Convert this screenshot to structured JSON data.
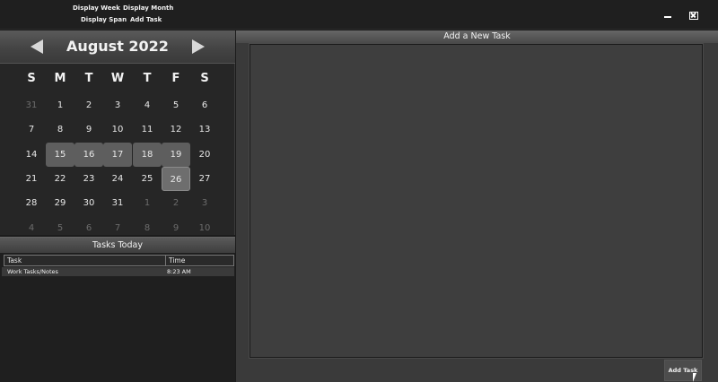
{
  "menu": {
    "display_week": "Display Week",
    "display_month": "Display Month",
    "display_span": "Display Span",
    "add_task": "Add Task"
  },
  "calendar": {
    "title": "August 2022",
    "weekdays": [
      "S",
      "M",
      "T",
      "W",
      "T",
      "F",
      "S"
    ],
    "weeks": [
      [
        "31",
        "1",
        "2",
        "3",
        "4",
        "5",
        "6"
      ],
      [
        "7",
        "8",
        "9",
        "10",
        "11",
        "12",
        "13"
      ],
      [
        "14",
        "15",
        "16",
        "17",
        "18",
        "19",
        "20"
      ],
      [
        "21",
        "22",
        "23",
        "24",
        "25",
        "26",
        "27"
      ],
      [
        "28",
        "29",
        "30",
        "31",
        "1",
        "2",
        "3"
      ],
      [
        "4",
        "5",
        "6",
        "7",
        "8",
        "9",
        "10"
      ]
    ],
    "selected_days": [
      "15",
      "16",
      "17",
      "18",
      "19"
    ],
    "today": "26"
  },
  "tasks_today": {
    "title": "Tasks Today",
    "columns": [
      "Task",
      "Time"
    ],
    "rows": [
      {
        "task": "Work Tasks/Notes",
        "time": "8:23 AM"
      }
    ]
  },
  "add_panel": {
    "title": "Add a New Task",
    "task_text": "",
    "button_label": "Add Task"
  },
  "icons": {
    "prev": "chevron-left-icon",
    "next": "chevron-right-icon",
    "minimize": "minimize-icon",
    "close": "close-icon"
  },
  "colors": {
    "background": "#1c1c1c",
    "panel": "#3a3a3a",
    "selected_day": "#5e5e5e"
  }
}
